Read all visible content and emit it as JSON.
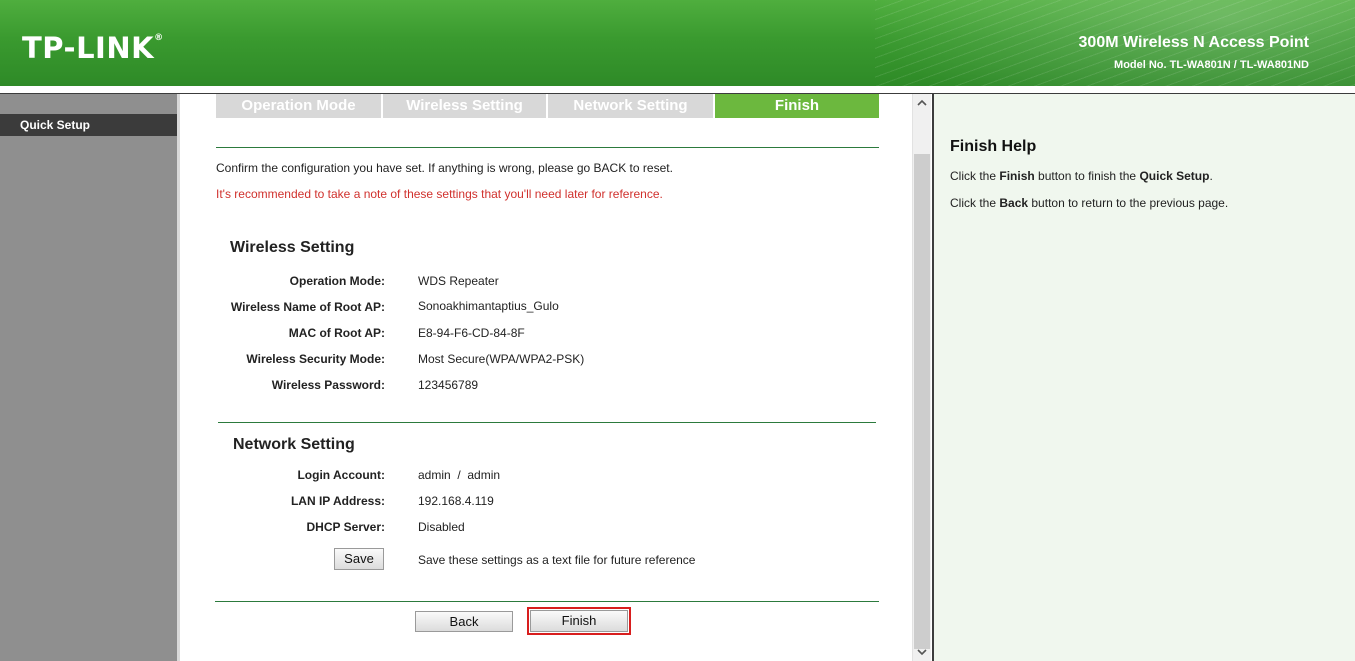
{
  "header": {
    "logo": "TP-LINK",
    "logo_mark": "®",
    "product": "300M Wireless N Access Point",
    "model": "Model No. TL-WA801N / TL-WA801ND"
  },
  "sidebar": {
    "items": [
      {
        "label": "Quick Setup"
      }
    ]
  },
  "tabs": [
    {
      "label": "Operation Mode"
    },
    {
      "label": "Wireless Setting"
    },
    {
      "label": "Network Setting"
    },
    {
      "label": "Finish"
    }
  ],
  "main": {
    "confirm_text": "Confirm the configuration you have set. If anything is wrong, please go BACK to reset.",
    "note_text": "It's recommended to take a note of these settings that you'll need later for reference.",
    "wireless": {
      "title": "Wireless Setting",
      "rows": [
        {
          "label": "Operation Mode:",
          "value": "WDS Repeater"
        },
        {
          "label": "Wireless Name of Root AP:",
          "value": "Sonoakhimantaptius_Gulo"
        },
        {
          "label": "MAC of Root AP:",
          "value": "E8-94-F6-CD-84-8F"
        },
        {
          "label": "Wireless Security Mode:",
          "value": "Most Secure(WPA/WPA2-PSK)"
        },
        {
          "label": "Wireless Password:",
          "value": "123456789"
        }
      ]
    },
    "network": {
      "title": "Network Setting",
      "rows": [
        {
          "label": "Login Account:",
          "value": "admin  /  admin"
        },
        {
          "label": "LAN IP Address:",
          "value": "192.168.4.119"
        },
        {
          "label": "DHCP Server:",
          "value": "Disabled"
        }
      ]
    },
    "save_button": "Save",
    "save_text": "Save these settings as a text file for future reference",
    "back_button": "Back",
    "finish_button": "Finish"
  },
  "help": {
    "title": "Finish Help",
    "line1": {
      "pre": "Click the ",
      "b1": "Finish",
      "mid": " button to finish the ",
      "b2": "Quick Setup",
      "post": "."
    },
    "line2": {
      "pre": "Click the ",
      "b1": "Back",
      "mid": " button to return to the previous page."
    }
  },
  "colors": {
    "header_green": "#3a9a2f",
    "active_tab": "#6cb83e",
    "inactive_tab": "#d8d8d8",
    "note_red": "#d0312d",
    "sidebar_gray": "#8f8f8f",
    "help_bg": "#f0f7ee",
    "finish_highlight": "#d81e1e"
  },
  "icons": {
    "scroll_up": "chevron-up-icon",
    "scroll_down": "chevron-down-icon"
  }
}
